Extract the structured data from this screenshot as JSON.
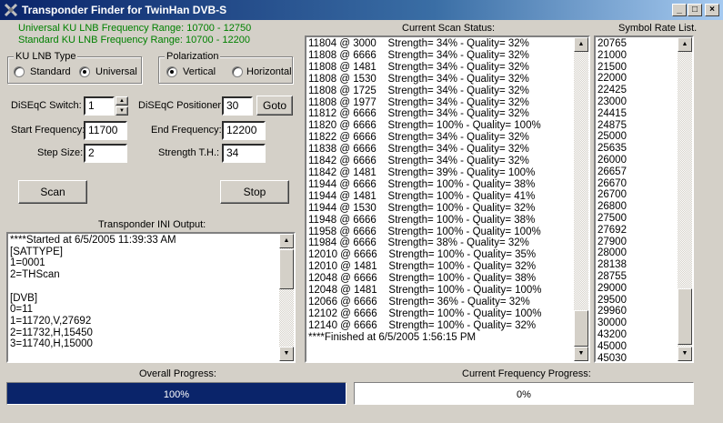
{
  "window": {
    "title": "Transponder Finder for TwinHan DVB-S",
    "minimize": "_",
    "maximize": "□",
    "close": "×"
  },
  "ranges": {
    "universal": "Universal KU LNB Frequency Range: 10700 - 12750",
    "standard": "Standard KU LNB Frequency Range: 10700 - 12200"
  },
  "lnb_type": {
    "label": "KU LNB Type",
    "standard": "Standard",
    "universal": "Universal",
    "selected": "universal"
  },
  "polarization": {
    "label": "Polarization",
    "vertical": "Vertical",
    "horizontal": "Horizontal",
    "selected": "vertical"
  },
  "form": {
    "diseqc_switch_label": "DiSEqC Switch:",
    "diseqc_switch_value": "1",
    "diseqc_positioner_label": "DiSEqC Positioner:",
    "diseqc_positioner_value": "30",
    "goto_label": "Goto",
    "start_freq_label": "Start Frequency:",
    "start_freq_value": "11700",
    "end_freq_label": "End Frequency:",
    "end_freq_value": "12200",
    "step_size_label": "Step Size:",
    "step_size_value": "2",
    "strength_th_label": "Strength T.H.:",
    "strength_th_value": "34",
    "scan_label": "Scan",
    "stop_label": "Stop"
  },
  "ini_output": {
    "label": "Transponder INI Output:",
    "lines": [
      "****Started at 6/5/2005 11:39:33 AM",
      "[SATTYPE]",
      "1=0001",
      "2=THScan",
      "",
      "[DVB]",
      "0=11",
      "1=11720,V,27692",
      "2=11732,H,15450",
      "3=11740,H,15000"
    ]
  },
  "scan_status": {
    "label": "Current Scan Status:",
    "lines": [
      "11804 @ 3000    Strength= 34% - Quality= 32%",
      "11808 @ 6666    Strength= 34% - Quality= 32%",
      "11808 @ 1481    Strength= 34% - Quality= 32%",
      "11808 @ 1530    Strength= 34% - Quality= 32%",
      "11808 @ 1725    Strength= 34% - Quality= 32%",
      "11808 @ 1977    Strength= 34% - Quality= 32%",
      "11812 @ 6666    Strength= 34% - Quality= 32%",
      "11820 @ 6666    Strength= 100% - Quality= 100%",
      "11822 @ 6666    Strength= 34% - Quality= 32%",
      "11838 @ 6666    Strength= 34% - Quality= 32%",
      "11842 @ 6666    Strength= 34% - Quality= 32%",
      "11842 @ 1481    Strength= 39% - Quality= 100%",
      "11944 @ 6666    Strength= 100% - Quality= 38%",
      "11944 @ 1481    Strength= 100% - Quality= 41%",
      "11944 @ 1530    Strength= 100% - Quality= 32%",
      "11948 @ 6666    Strength= 100% - Quality= 38%",
      "11958 @ 6666    Strength= 100% - Quality= 100%",
      "11984 @ 6666    Strength= 38% - Quality= 32%",
      "12010 @ 6666    Strength= 100% - Quality= 35%",
      "12010 @ 1481    Strength= 100% - Quality= 32%",
      "12048 @ 6666    Strength= 100% - Quality= 38%",
      "12048 @ 1481    Strength= 100% - Quality= 100%",
      "12066 @ 6666    Strength= 36% - Quality= 32%",
      "12102 @ 6666    Strength= 100% - Quality= 100%",
      "12140 @ 6666    Strength= 100% - Quality= 32%",
      "****Finished at 6/5/2005 1:56:15 PM"
    ]
  },
  "symbol_rates": {
    "label": "Symbol Rate List.",
    "items": [
      "20765",
      "21000",
      "21500",
      "22000",
      "22425",
      "23000",
      "24415",
      "24875",
      "25000",
      "25635",
      "26000",
      "26657",
      "26670",
      "26700",
      "26800",
      "27500",
      "27692",
      "27900",
      "28000",
      "28138",
      "28755",
      "29000",
      "29500",
      "29960",
      "30000",
      "43200",
      "45000",
      "45030"
    ]
  },
  "progress": {
    "overall_label": "Overall Progress:",
    "overall_text": "100%",
    "overall_fraction": 1.0,
    "freq_label": "Current Frequency Progress:",
    "freq_text": "0%",
    "freq_fraction": 0.0
  }
}
